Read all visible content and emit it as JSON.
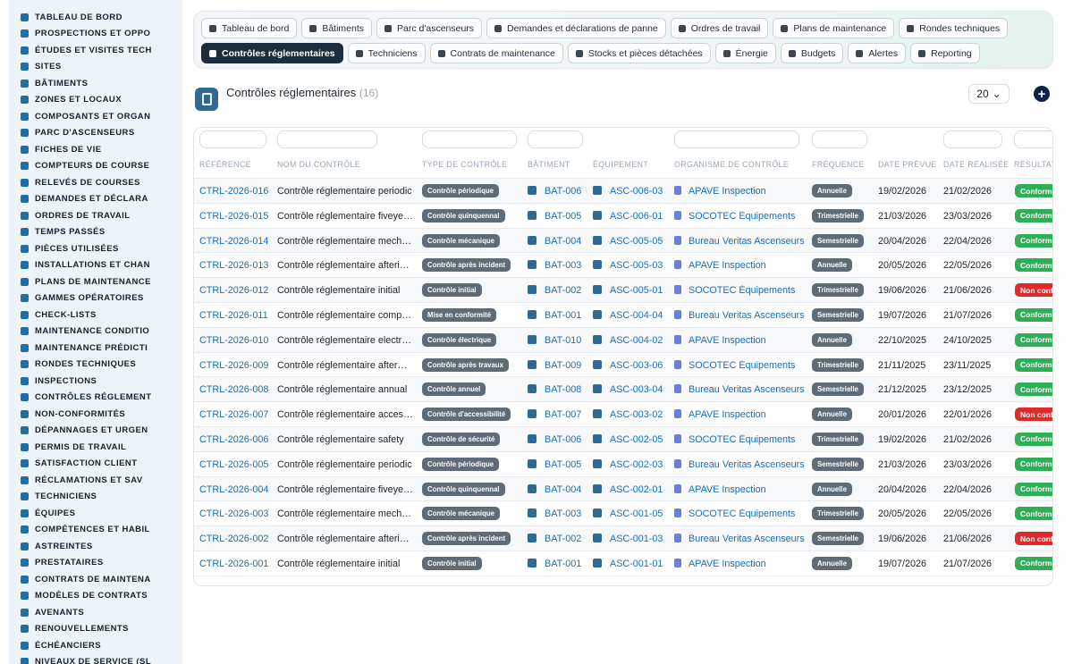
{
  "sidebar": {
    "items": [
      {
        "label": "TABLEAU DE BORD",
        "icon": "dashboard-icon"
      },
      {
        "label": "PROSPECTIONS ET OPPO",
        "icon": "target-icon"
      },
      {
        "label": "ÉTUDES ET VISITES TECH",
        "icon": "ruler-icon"
      },
      {
        "label": "SITES",
        "icon": "map-pin-icon"
      },
      {
        "label": "BÂTIMENTS",
        "icon": "building-icon"
      },
      {
        "label": "ZONES ET LOCAUX",
        "icon": "floor-plan-icon"
      },
      {
        "label": "COMPOSANTS ET ORGAN",
        "icon": "sitemap-icon"
      },
      {
        "label": "PARC D'ASCENSEURS",
        "icon": "cogs-icon"
      },
      {
        "label": "FICHES DE VIE",
        "icon": "history-icon"
      },
      {
        "label": "COMPTEURS DE COURSE",
        "icon": "gauge-icon"
      },
      {
        "label": "RELEVÉS DE COURSES",
        "icon": "clipboard-icon"
      },
      {
        "label": "DEMANDES ET DÉCLARA",
        "icon": "question-circle-icon"
      },
      {
        "label": "ORDRES DE TRAVAIL",
        "icon": "clipboard-list-icon"
      },
      {
        "label": "TEMPS PASSÉS",
        "icon": "clock-icon"
      },
      {
        "label": "PIÈCES UTILISÉES",
        "icon": "box-icon"
      },
      {
        "label": "INSTALLATIONS ET CHAN",
        "icon": "wrench-icon"
      },
      {
        "label": "PLANS DE MAINTENANCE",
        "icon": "calendar-icon"
      },
      {
        "label": "GAMMES OPÉRATOIRES",
        "icon": "tasks-icon"
      },
      {
        "label": "CHECK-LISTS",
        "icon": "list-icon"
      },
      {
        "label": "MAINTENANCE CONDITIO",
        "icon": "thermometer-icon"
      },
      {
        "label": "MAINTENANCE PRÉDICTI",
        "icon": "chart-line-icon"
      },
      {
        "label": "RONDES TECHNIQUES",
        "icon": "route-icon"
      },
      {
        "label": "INSPECTIONS",
        "icon": "search-icon"
      },
      {
        "label": "CONTRÔLES RÉGLEMENT",
        "icon": "clipboard-check-icon"
      },
      {
        "label": "NON-CONFORMITÉS",
        "icon": "exclamation-circle-icon"
      },
      {
        "label": "DÉPANNAGES ET URGEN",
        "icon": "warning-icon"
      },
      {
        "label": "PERMIS DE TRAVAIL",
        "icon": "id-card-icon"
      },
      {
        "label": "SATISFACTION CLIENT",
        "icon": "smile-icon"
      },
      {
        "label": "RÉCLAMATIONS ET SAV",
        "icon": "comment-icon"
      },
      {
        "label": "TECHNICIENS",
        "icon": "hard-hat-icon"
      },
      {
        "label": "ÉQUIPES",
        "icon": "users-icon"
      },
      {
        "label": "COMPÉTENCES ET HABIL",
        "icon": "certificate-icon"
      },
      {
        "label": "ASTREINTES",
        "icon": "phone-icon"
      },
      {
        "label": "PRESTATAIRES",
        "icon": "handshake-icon"
      },
      {
        "label": "CONTRATS DE MAINTENA",
        "icon": "file-contract-icon"
      },
      {
        "label": "MODÈLES DE CONTRATS",
        "icon": "copy-icon"
      },
      {
        "label": "AVENANTS",
        "icon": "file-signature-icon"
      },
      {
        "label": "RENOUVELLEMENTS",
        "icon": "sync-icon"
      },
      {
        "label": "ÉCHÉANCIERS",
        "icon": "calendar-alt-icon"
      },
      {
        "label": "NIVEAUX DE SERVICE (SL",
        "icon": "sliders-icon"
      }
    ]
  },
  "tabs": {
    "row1": [
      {
        "label": "Tableau de bord",
        "icon": "dashboard-icon"
      },
      {
        "label": "Bâtiments",
        "icon": "building-icon"
      },
      {
        "label": "Parc d'ascenseurs",
        "icon": "cogs-icon"
      },
      {
        "label": "Demandes et déclarations de panne",
        "icon": "question-circle-icon"
      },
      {
        "label": "Ordres de travail",
        "icon": "clipboard-list-icon"
      },
      {
        "label": "Plans de maintenance",
        "icon": "calendar-icon"
      },
      {
        "label": "Rondes techniques",
        "icon": "route-icon"
      }
    ],
    "row2": [
      {
        "label": "Contrôles réglementaires",
        "icon": "clipboard-check-icon",
        "active": true
      },
      {
        "label": "Techniciens",
        "icon": "hard-hat-icon"
      },
      {
        "label": "Contrats de maintenance",
        "icon": "file-contract-icon"
      },
      {
        "label": "Stocks et pièces détachées",
        "icon": "boxes-icon"
      },
      {
        "label": "Énergie",
        "icon": "bolt-icon"
      },
      {
        "label": "Budgets",
        "icon": "money-icon"
      },
      {
        "label": "Alertes",
        "icon": "bell-icon"
      },
      {
        "label": "Reporting",
        "icon": "chart-pie-icon"
      }
    ]
  },
  "page": {
    "title": "Contrôles réglementaires",
    "count": "(16)",
    "page_size": "20",
    "add_label": "+"
  },
  "table": {
    "columns": [
      "RÉFÉRENCE",
      "NOM DU CONTRÔLE",
      "TYPE DE CONTRÔLE",
      "BÂTIMENT",
      "ÉQUIPEMENT",
      "ORGANISME DE CONTRÔLE",
      "FRÉQUENCE",
      "DATE PRÉVUE",
      "DATE RÉALISÉE",
      "RÉSULTAT"
    ],
    "rows": [
      {
        "ref": "CTRL-2026-016",
        "name": "Contrôle réglementaire periodic",
        "type": "Contrôle périodique",
        "bat": "BAT-006",
        "eq": "ASC-006-03",
        "org": "APAVE Inspection",
        "freq": "Annuelle",
        "prevue": "19/02/2026",
        "realisee": "21/02/2026",
        "result": "Conforme"
      },
      {
        "ref": "CTRL-2026-015",
        "name": "Contrôle réglementaire fiveyearly",
        "type": "Contrôle quinquennal",
        "bat": "BAT-005",
        "eq": "ASC-006-01",
        "org": "SOCOTEC Équipements",
        "freq": "Trimestrielle",
        "prevue": "21/03/2026",
        "realisee": "23/03/2026",
        "result": "Conforme"
      },
      {
        "ref": "CTRL-2026-014",
        "name": "Contrôle réglementaire mechanical",
        "type": "Contrôle mécanique",
        "bat": "BAT-004",
        "eq": "ASC-005-05",
        "org": "Bureau Veritas Ascenseurs",
        "freq": "Semestrielle",
        "prevue": "20/04/2026",
        "realisee": "22/04/2026",
        "result": "Conforme"
      },
      {
        "ref": "CTRL-2026-013",
        "name": "Contrôle réglementaire afterincident",
        "type": "Contrôle après incident",
        "bat": "BAT-003",
        "eq": "ASC-005-03",
        "org": "APAVE Inspection",
        "freq": "Annuelle",
        "prevue": "20/05/2026",
        "realisee": "22/05/2026",
        "result": "Conforme"
      },
      {
        "ref": "CTRL-2026-012",
        "name": "Contrôle réglementaire initial",
        "type": "Contrôle initial",
        "bat": "BAT-002",
        "eq": "ASC-005-01",
        "org": "SOCOTEC Équipements",
        "freq": "Trimestrielle",
        "prevue": "19/06/2026",
        "realisee": "21/06/2026",
        "result": "Non conforme"
      },
      {
        "ref": "CTRL-2026-011",
        "name": "Contrôle réglementaire compliance",
        "type": "Mise en conformité",
        "bat": "BAT-001",
        "eq": "ASC-004-04",
        "org": "Bureau Veritas Ascenseurs",
        "freq": "Semestrielle",
        "prevue": "19/07/2026",
        "realisee": "21/07/2026",
        "result": "Conforme"
      },
      {
        "ref": "CTRL-2026-010",
        "name": "Contrôle réglementaire electrical",
        "type": "Contrôle électrique",
        "bat": "BAT-010",
        "eq": "ASC-004-02",
        "org": "APAVE Inspection",
        "freq": "Annuelle",
        "prevue": "22/10/2025",
        "realisee": "24/10/2025",
        "result": "Conforme"
      },
      {
        "ref": "CTRL-2026-009",
        "name": "Contrôle réglementaire afterworks",
        "type": "Contrôle après travaux",
        "bat": "BAT-009",
        "eq": "ASC-003-06",
        "org": "SOCOTEC Équipements",
        "freq": "Trimestrielle",
        "prevue": "21/11/2025",
        "realisee": "23/11/2025",
        "result": "Conforme"
      },
      {
        "ref": "CTRL-2026-008",
        "name": "Contrôle réglementaire annual",
        "type": "Contrôle annuel",
        "bat": "BAT-008",
        "eq": "ASC-003-04",
        "org": "Bureau Veritas Ascenseurs",
        "freq": "Semestrielle",
        "prevue": "21/12/2025",
        "realisee": "23/12/2025",
        "result": "Conforme"
      },
      {
        "ref": "CTRL-2026-007",
        "name": "Contrôle réglementaire accessibility",
        "type": "Contrôle d'accessibilité",
        "bat": "BAT-007",
        "eq": "ASC-003-02",
        "org": "APAVE Inspection",
        "freq": "Annuelle",
        "prevue": "20/01/2026",
        "realisee": "22/01/2026",
        "result": "Non conforme"
      },
      {
        "ref": "CTRL-2026-006",
        "name": "Contrôle réglementaire safety",
        "type": "Contrôle de sécurité",
        "bat": "BAT-006",
        "eq": "ASC-002-05",
        "org": "SOCOTEC Équipements",
        "freq": "Trimestrielle",
        "prevue": "19/02/2026",
        "realisee": "21/02/2026",
        "result": "Conforme"
      },
      {
        "ref": "CTRL-2026-005",
        "name": "Contrôle réglementaire periodic",
        "type": "Contrôle périodique",
        "bat": "BAT-005",
        "eq": "ASC-002-03",
        "org": "Bureau Veritas Ascenseurs",
        "freq": "Semestrielle",
        "prevue": "21/03/2026",
        "realisee": "23/03/2026",
        "result": "Conforme"
      },
      {
        "ref": "CTRL-2026-004",
        "name": "Contrôle réglementaire fiveyearly",
        "type": "Contrôle quinquennal",
        "bat": "BAT-004",
        "eq": "ASC-002-01",
        "org": "APAVE Inspection",
        "freq": "Annuelle",
        "prevue": "20/04/2026",
        "realisee": "22/04/2026",
        "result": "Conforme"
      },
      {
        "ref": "CTRL-2026-003",
        "name": "Contrôle réglementaire mechanical",
        "type": "Contrôle mécanique",
        "bat": "BAT-003",
        "eq": "ASC-001-05",
        "org": "SOCOTEC Équipements",
        "freq": "Trimestrielle",
        "prevue": "20/05/2026",
        "realisee": "22/05/2026",
        "result": "Conforme"
      },
      {
        "ref": "CTRL-2026-002",
        "name": "Contrôle réglementaire afterincident",
        "type": "Contrôle après incident",
        "bat": "BAT-002",
        "eq": "ASC-001-03",
        "org": "Bureau Veritas Ascenseurs",
        "freq": "Semestrielle",
        "prevue": "19/06/2026",
        "realisee": "21/06/2026",
        "result": "Non conforme"
      },
      {
        "ref": "CTRL-2026-001",
        "name": "Contrôle réglementaire initial",
        "type": "Contrôle initial",
        "bat": "BAT-001",
        "eq": "ASC-001-01",
        "org": "APAVE Inspection",
        "freq": "Annuelle",
        "prevue": "19/07/2026",
        "realisee": "21/07/2026",
        "result": "Conforme"
      }
    ]
  },
  "colors": {
    "accent": "#1b6db5",
    "conforme": "#2eae55",
    "non_conforme": "#e0292b",
    "badge": "#5f6b76",
    "active_tab": "#1a2e3f"
  }
}
